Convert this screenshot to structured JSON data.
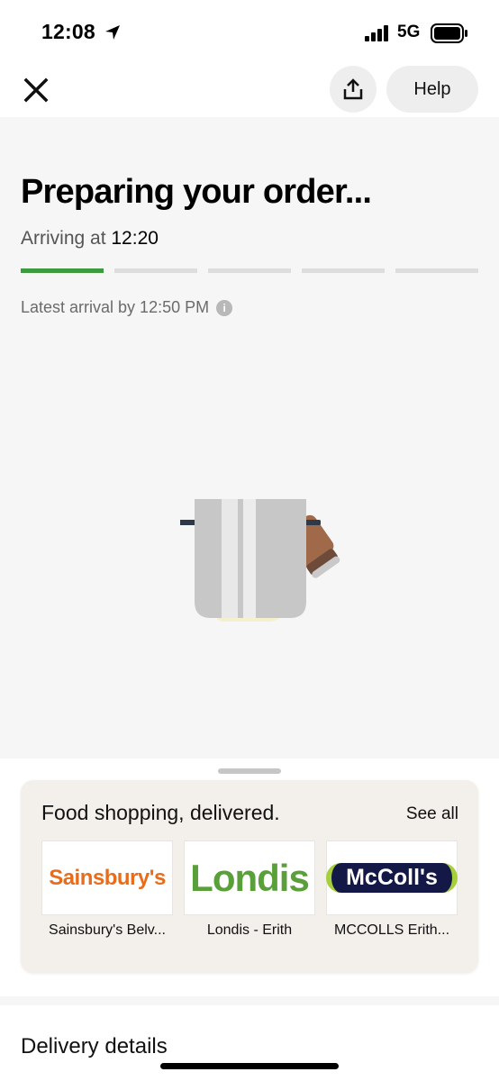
{
  "status_bar": {
    "time": "12:08",
    "network": "5G",
    "icons": [
      "location-arrow-icon",
      "signal-icon",
      "battery-icon"
    ]
  },
  "nav": {
    "close_icon": "close-icon",
    "share_icon": "share-icon",
    "help_label": "Help"
  },
  "order": {
    "title": "Preparing your order...",
    "arriving_label": "Arriving at",
    "arriving_time": "12:20",
    "progress_steps_total": 5,
    "progress_steps_done": 1,
    "latest_arrival": "Latest arrival by 12:50 PM",
    "progress_color": "#3e9a3e"
  },
  "shopping": {
    "title": "Food shopping, delivered.",
    "see_all_label": "See all",
    "stores": [
      {
        "logo_text": "Sainsbury's",
        "name": "Sainsbury's Belv...",
        "brand_color": "#e76c1c"
      },
      {
        "logo_text": "Londis",
        "name": "Londis - Erith",
        "brand_color": "#5aa03a"
      },
      {
        "logo_text": "McColl's",
        "name": "MCCOLLS Erith...",
        "brand_color": "#141846"
      }
    ]
  },
  "delivery": {
    "heading": "Delivery details"
  }
}
